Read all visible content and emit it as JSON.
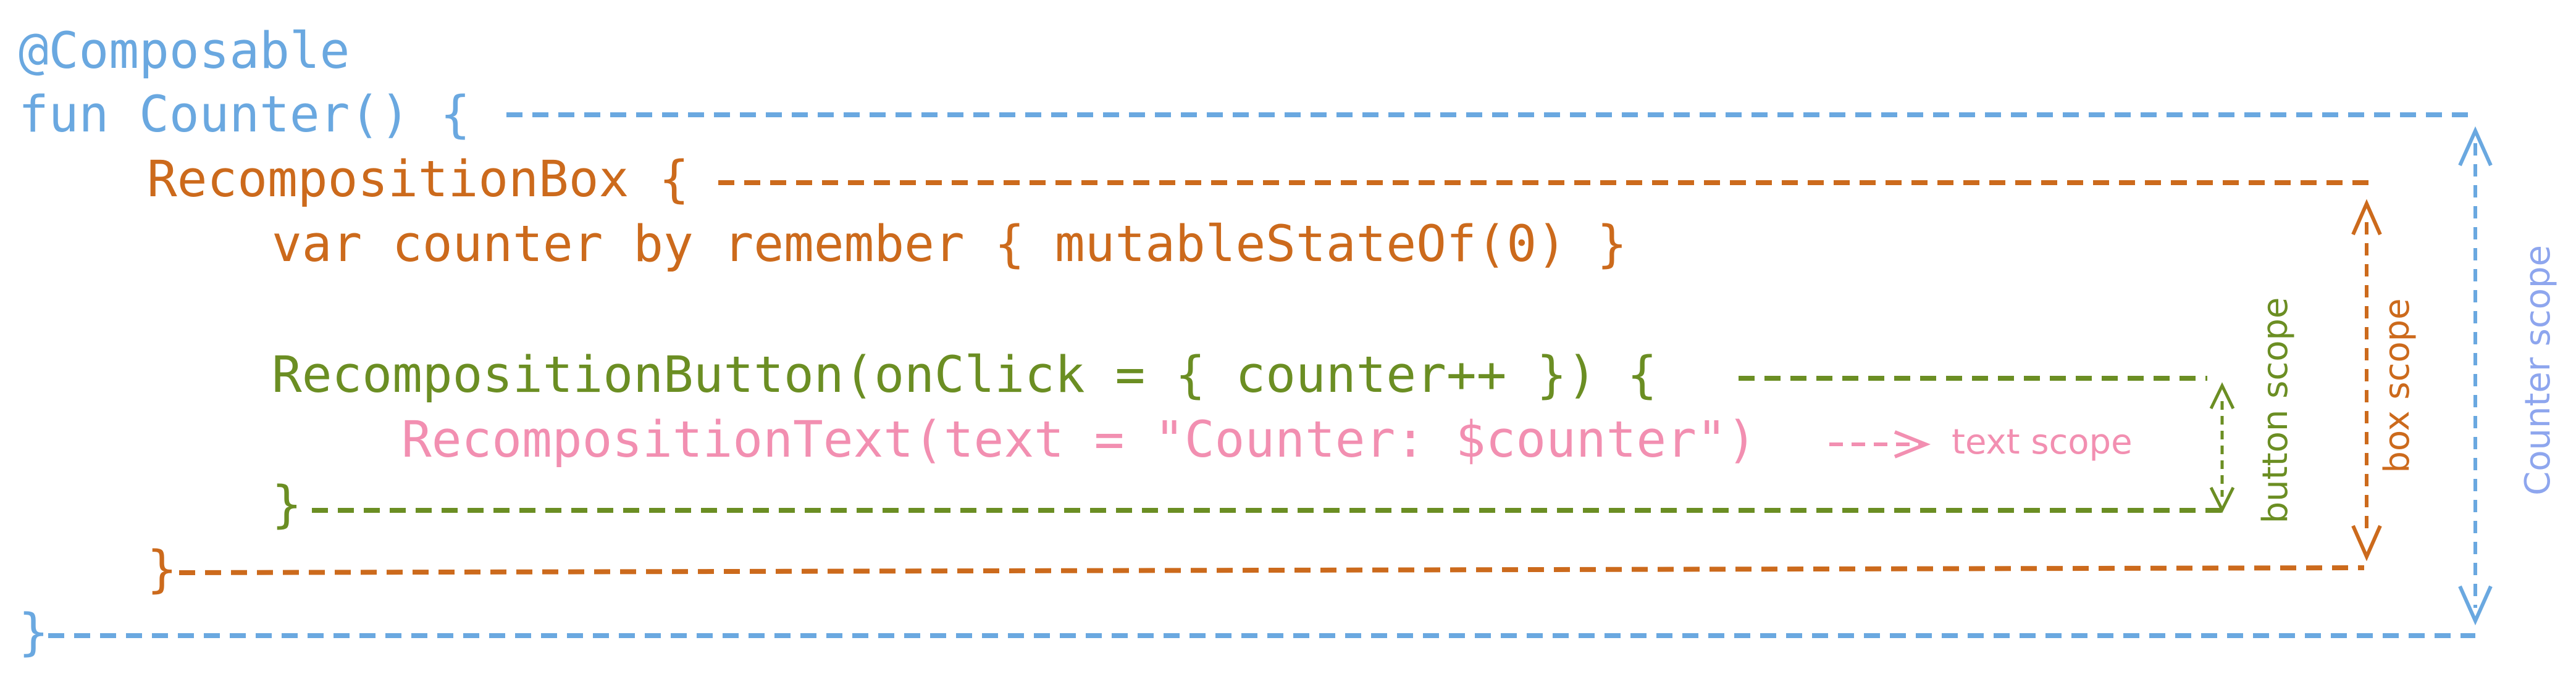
{
  "colors": {
    "counter": "#6aa8e0",
    "box": "#cc6a1c",
    "button": "#6b8e23",
    "text": "#f28fb1",
    "counter_label": "#8ea6ee"
  },
  "code": {
    "annotation": "@Composable",
    "fun_open": "fun Counter() {",
    "box_open": "RecompositionBox {",
    "state_line": "var counter by remember { mutableStateOf(0) }",
    "button_open": "RecompositionButton(onClick = { counter++ }) {",
    "text_call": "RecompositionText(text = \"Counter: $counter\")",
    "button_close": "}",
    "box_close": "}",
    "fun_close": "}"
  },
  "scopes": {
    "text": "text scope",
    "button": "button scope",
    "box": "box scope",
    "counter": "Counter scope"
  }
}
